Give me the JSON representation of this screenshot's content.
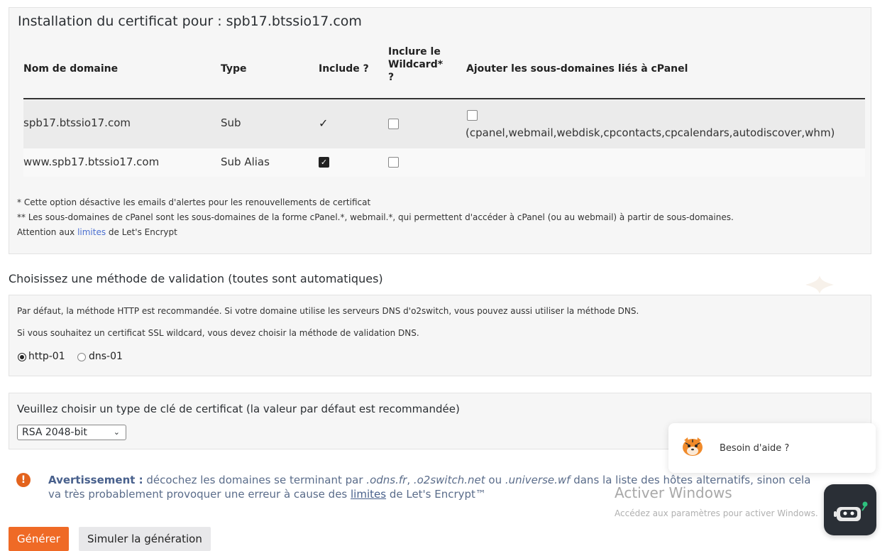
{
  "install": {
    "title": "Installation du certificat pour : spb17.btssio17.com",
    "columns": {
      "domain": "Nom de domaine",
      "type": "Type",
      "include": "Include ?",
      "wildcard_l1": "Inclure le",
      "wildcard_l2": "Wildcard*",
      "wildcard_l3": "?",
      "subdomains": "Ajouter les sous-domaines liés à cPanel"
    },
    "rows": [
      {
        "domain": "spb17.btssio17.com",
        "type": "Sub",
        "include_mark": "✓",
        "wildcard": false,
        "cpanel": false,
        "cpanel_list": "(cpanel,webmail,webdisk,cpcontacts,cpcalendars,autodiscover,whm)"
      },
      {
        "domain": "www.spb17.btssio17.com",
        "type": "Sub Alias",
        "include": true,
        "wildcard": false
      }
    ],
    "notes": {
      "n1": "* Cette option désactive les emails d'alertes pour les renouvellements de certificat",
      "n2": "** Les sous-domaines de cPanel sont les sous-domaines de la forme cPanel.*, webmail.*, qui permettent d'accéder à cPanel (ou au webmail) à partir de sous-domaines.",
      "n3_pre": "Attention aux ",
      "n3_link": "limites",
      "n3_post": " de Let's Encrypt"
    }
  },
  "validation": {
    "heading": "Choisissez une méthode de validation (toutes sont automatiques)",
    "p1": "Par défaut, la méthode HTTP est recommandée. Si votre domaine utilise les serveurs DNS d'o2switch, vous pouvez aussi utiliser la méthode DNS.",
    "p2": "Si vous souhaitez un certificat SSL wildcard, vous devez choisir la méthode de validation DNS.",
    "options": [
      "http-01",
      "dns-01"
    ],
    "selected": "http-01"
  },
  "keytype": {
    "label": "Veuillez choisir un type de clé de certificat (la valeur par défaut est recommandée)",
    "selected": "RSA 2048-bit"
  },
  "warning": {
    "icon": "exclamation-icon",
    "title": "Avertissement :",
    "t1": " décochez les domaines se terminant par ",
    "d1": ".odns.fr",
    "sep1": ", ",
    "d2": ".o2switch.net",
    "t2": " ou ",
    "d3": ".universe.wf",
    "t3": " dans la liste des hôtes alternatifs, sinon cela va très probablement provoquer une erreur à cause des ",
    "link": "limites",
    "t4": " de Let's Encrypt™"
  },
  "buttons": {
    "generate": "Générer",
    "simulate": "Simuler la génération"
  },
  "overlay": {
    "win_title": "Activer Windows",
    "win_sub": "Accédez aux paramètres pour activer Windows.",
    "help_text": "Besoin d'aide ?"
  },
  "colors": {
    "accent": "#ef6a26",
    "warning": "#e3631d",
    "link": "#4a6fd0"
  }
}
